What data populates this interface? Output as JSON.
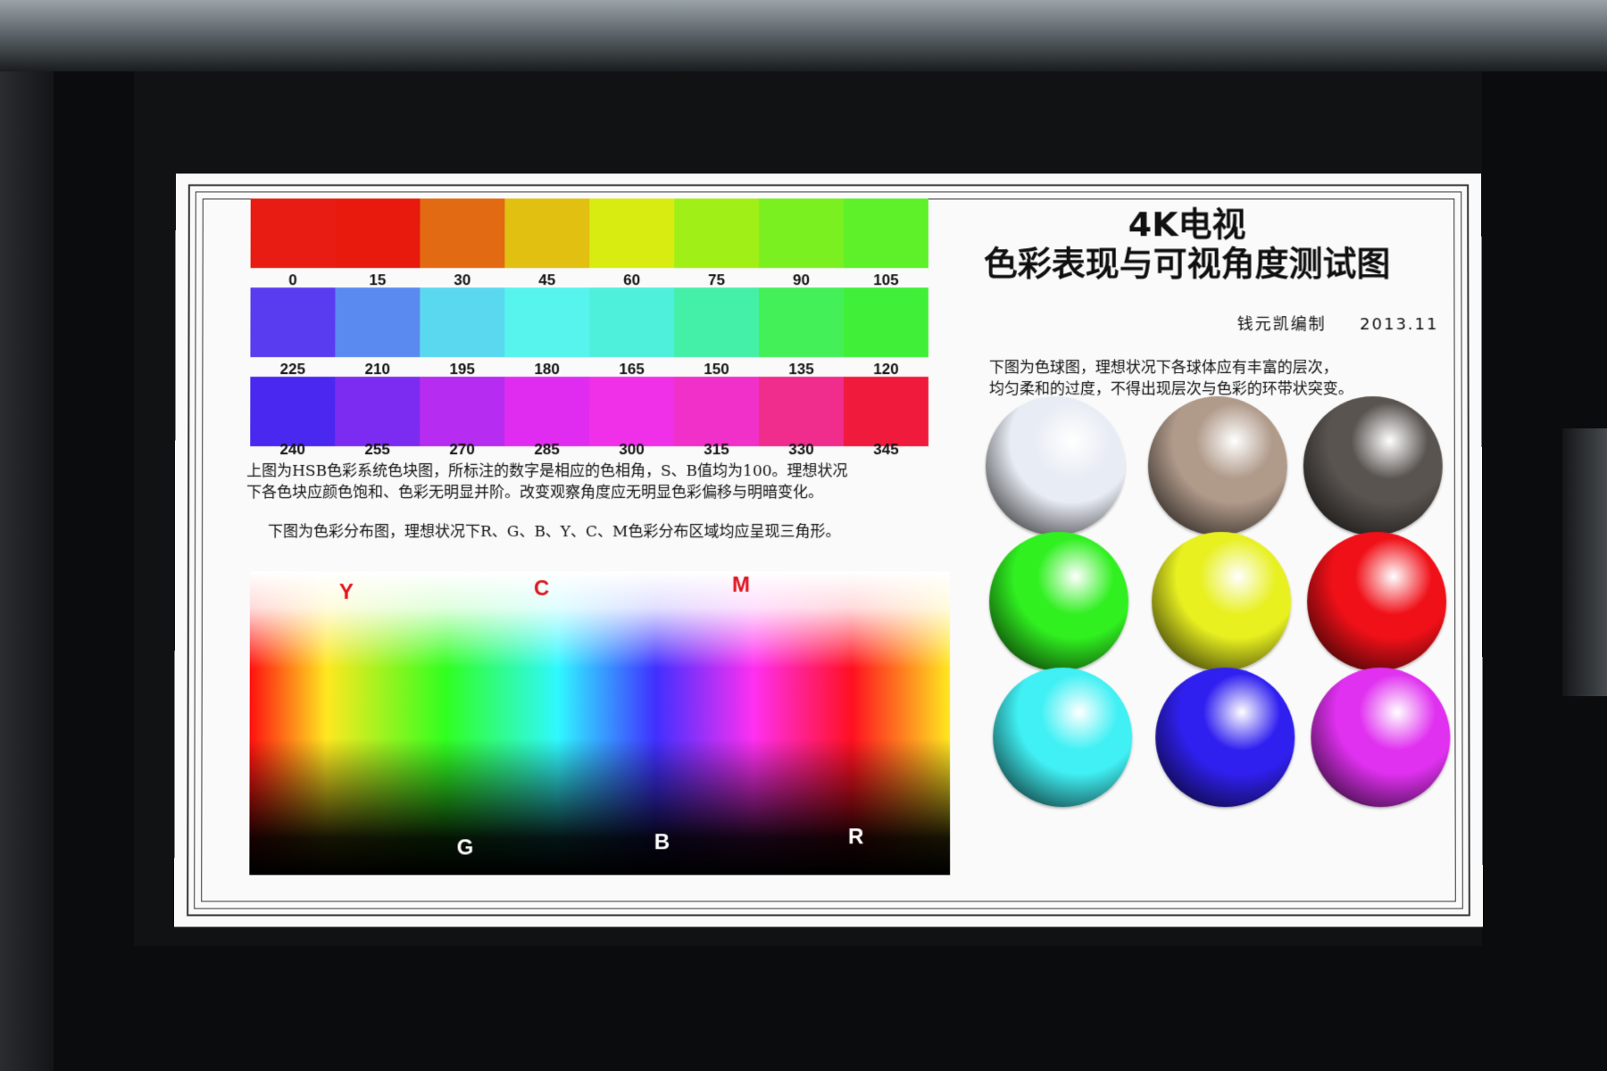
{
  "chart": {
    "title_line1": "4K电视",
    "title_line2": "色彩表现与可视角度测试图",
    "author": "钱元凯编制",
    "date": "2013.11",
    "hue_rows": [
      {
        "labels": [
          "0",
          "15",
          "30",
          "45",
          "60",
          "75",
          "90",
          "105"
        ],
        "colors": [
          "#e81c12",
          "#e81a0e",
          "#e26a12",
          "#e2c012",
          "#d8ec12",
          "#a0f018",
          "#7af020",
          "#5ef028"
        ]
      },
      {
        "labels": [
          "225",
          "210",
          "195",
          "180",
          "165",
          "150",
          "135",
          "120"
        ],
        "colors": [
          "#5a3cf0",
          "#5a8af0",
          "#5ad8f0",
          "#56f4ec",
          "#4ef0dc",
          "#44f0a8",
          "#44f058",
          "#40f038"
        ]
      },
      {
        "labels": [
          "240",
          "255",
          "270",
          "285",
          "300",
          "315",
          "330",
          "345"
        ],
        "colors": [
          "#4a28f0",
          "#7c2cf0",
          "#b62cf0",
          "#e02cf0",
          "#f030e8",
          "#f030c8",
          "#f02c8c",
          "#f01a3c"
        ]
      }
    ],
    "hsb_desc_line1": "上图为HSB色彩系统色块图，所标注的数字是相应的色相角，S、B值均为100。理想状况",
    "hsb_desc_line2": "下各色块应颜色饱和、色彩无明显并阶。改变观察角度应无明显色彩偏移与明暗变化。",
    "gamut_desc": "下图为色彩分布图，理想状况下R、G、B、Y、C、M色彩分布区域均应呈现三角形。",
    "gamut_labels": {
      "y": "Y",
      "c": "C",
      "m": "M",
      "g": "G",
      "b": "B",
      "r": "R",
      "top_color": "#e0141e"
    },
    "sphere_desc_line1": "下图为色球图，理想状况下各球体应有丰富的层次，",
    "sphere_desc_line2": "均匀柔和的过度，不得出现层次与色彩的环带状突变。",
    "spheres": [
      {
        "name": "white-sphere",
        "color": "#e8ecf4"
      },
      {
        "name": "gray-sphere",
        "color": "#b09a8a"
      },
      {
        "name": "dark-sphere",
        "color": "#5a5450"
      },
      {
        "name": "green-sphere",
        "color": "#30f020"
      },
      {
        "name": "yellow-sphere",
        "color": "#e8f020"
      },
      {
        "name": "red-sphere",
        "color": "#f01018"
      },
      {
        "name": "cyan-sphere",
        "color": "#40f0f4"
      },
      {
        "name": "blue-sphere",
        "color": "#3020f0"
      },
      {
        "name": "magenta-sphere",
        "color": "#e030f0"
      }
    ]
  }
}
